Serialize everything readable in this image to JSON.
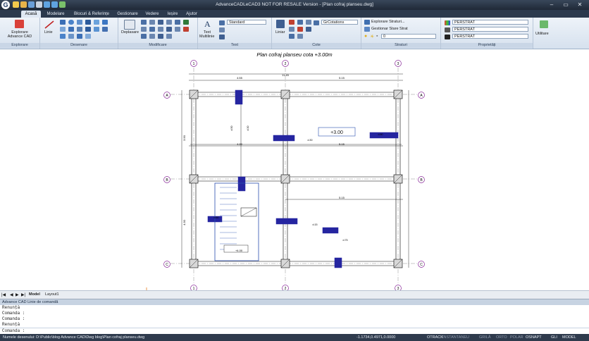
{
  "title_bar": {
    "logo": "G",
    "title": "AdvanceCADLeCAD3 NOT FOR RESALE Version - [Plan cofraj planseu.dwg]",
    "window_controls": [
      "–",
      "▭",
      "✕"
    ]
  },
  "ribbon_tabs": [
    "Acasă",
    "Modelare",
    "Blocuri & Referințe",
    "Gestionare",
    "Vedere",
    "Ieșire",
    "Ajutor"
  ],
  "ribbon": {
    "explorare": {
      "button_line1": "Explorare",
      "button_line2": "Advance CAD",
      "label": "Explorare"
    },
    "desenare": {
      "linie_label": "Linie",
      "label": "Desenare"
    },
    "modificare": {
      "deplasare_label": "Deplasare",
      "label": "Modificare"
    },
    "text": {
      "text_label": "Text",
      "multiline_label": "Multilinie",
      "style_combo": "Standard",
      "label": "Text"
    },
    "cote": {
      "liniar_label": "Liniar",
      "dimstyle_combo": "GrCotations",
      "label": "Cote"
    },
    "straturi": {
      "explorer_label": "Explorare Straturi...",
      "manager_label": "Gestionar Stare Strat",
      "layer_combo": "0",
      "label": "Straturi"
    },
    "proprietati": {
      "color_combo": "PERSTRAT",
      "linetype_combo": "PERSTRAT",
      "lineweight_combo": "PERSTRAT",
      "label": "Proprietăți"
    },
    "utilitare": {
      "label": "Utilitare"
    }
  },
  "drawing": {
    "title": "Plan cofraj planseu cota +3.00m",
    "axis_columns": [
      "1",
      "2",
      "3"
    ],
    "axis_rows": [
      "A",
      "B",
      "C"
    ],
    "level_label": "+3.00",
    "level_small": "+4.00",
    "top_dims": {
      "overall": "11.45",
      "bay1": "4.55",
      "bay2": "5.15"
    },
    "room_dims": {
      "top_width1": "4.20",
      "top_width2": "5.15",
      "bottom_width2": "5.15",
      "left_height_top": "3.90",
      "left_height_bottom": "4.30"
    },
    "beam_notes": [
      "d.50",
      "d.30",
      "d.30",
      "d.80",
      "d.15",
      "d.60",
      "d.75"
    ]
  },
  "bottom_tabs": {
    "model": "Model",
    "layout": "Layout1"
  },
  "command_window": {
    "header": "Advance CAD Linie de comandă",
    "lines": [
      "Renunță",
      "Comanda :",
      "Comanda :",
      "Renunță"
    ],
    "prompt": "Comanda :"
  },
  "status_bar": {
    "left_text": "Numele desenului: D:\\Public\\blog Advance CAD\\Dwg blog\\Plan cofraj planseu.dwg",
    "coords": "-1.1734,0.4971,0.0000",
    "toggles": [
      "OTRACK",
      "INSTANTANEU",
      "GRILĂ",
      "ORTO",
      "POLAR",
      "OSNAPT",
      "GLI",
      "MODEL"
    ]
  },
  "colors": {
    "title_bg": "#1f2937",
    "ribbon_bg": "#dfe8f3",
    "column_fill": "#2525a0",
    "axis_bubble": "#8a2b9a",
    "stair_line": "#2a4fb0"
  }
}
